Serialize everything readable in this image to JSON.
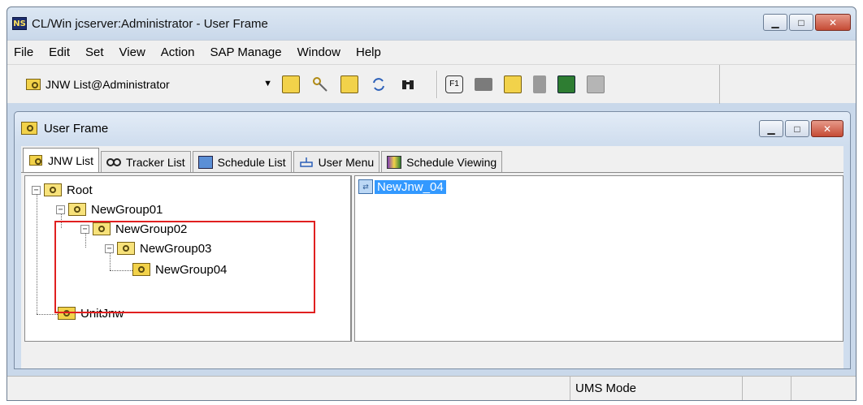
{
  "window": {
    "title": "CL/Win jcserver:Administrator - User Frame",
    "logo_text": "NS",
    "min_glyph": "▁",
    "max_glyph": "□",
    "close_glyph": "✕"
  },
  "menu": [
    {
      "label": "File"
    },
    {
      "label": "Edit"
    },
    {
      "label": "Set"
    },
    {
      "label": "View"
    },
    {
      "label": "Action"
    },
    {
      "label": "SAP Manage"
    },
    {
      "label": "Window"
    },
    {
      "label": "Help"
    }
  ],
  "toolbar": {
    "combo_value": "JNW List@Administrator",
    "caret": "▼",
    "icons": [
      "group-icon",
      "key-icon",
      "schedule-icon",
      "refresh-icon",
      "binoculars-icon",
      "f1-help-icon",
      "folder-icon",
      "tree-icon",
      "document-icon",
      "calendar-icon",
      "calendar-gray-icon"
    ]
  },
  "child": {
    "title": "User Frame",
    "tabs": [
      {
        "label": "JNW List",
        "active": true
      },
      {
        "label": "Tracker List"
      },
      {
        "label": "Schedule List"
      },
      {
        "label": "User Menu"
      },
      {
        "label": "Schedule Viewing"
      }
    ]
  },
  "tree": {
    "nodes": [
      {
        "label": "Root",
        "expander": "−"
      },
      {
        "label": "NewGroup01",
        "expander": "−"
      },
      {
        "label": "NewGroup02",
        "expander": "−"
      },
      {
        "label": "NewGroup03",
        "expander": "−"
      },
      {
        "label": "NewGroup04"
      },
      {
        "label": "UnitJnw"
      }
    ]
  },
  "list": {
    "items": [
      {
        "label": "NewJnw_04",
        "selected": true
      }
    ]
  },
  "status": {
    "mode": "UMS Mode"
  },
  "colors": {
    "highlight": "#e02020",
    "selection": "#3399ff",
    "folder": "#f2d24a"
  }
}
